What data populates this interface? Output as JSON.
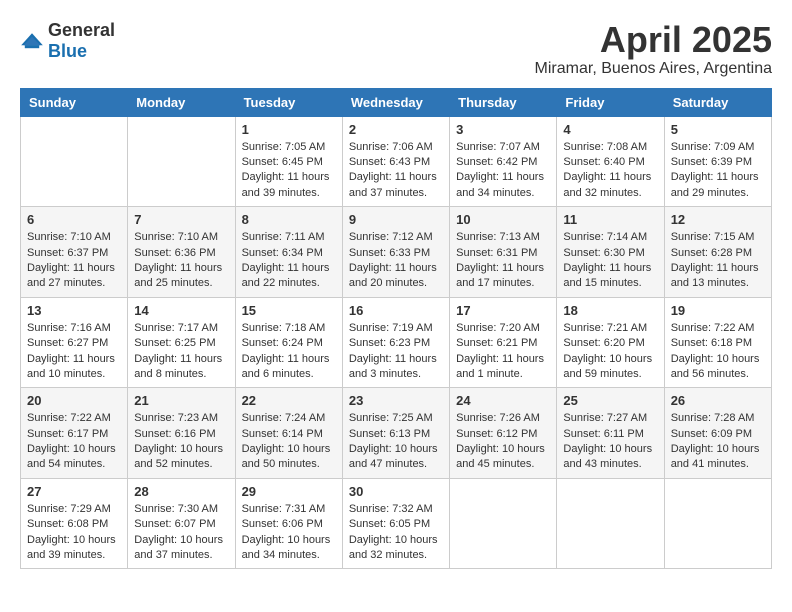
{
  "logo": {
    "general": "General",
    "blue": "Blue"
  },
  "header": {
    "title": "April 2025",
    "subtitle": "Miramar, Buenos Aires, Argentina"
  },
  "weekdays": [
    "Sunday",
    "Monday",
    "Tuesday",
    "Wednesday",
    "Thursday",
    "Friday",
    "Saturday"
  ],
  "weeks": [
    [
      {
        "day": "",
        "sunrise": "",
        "sunset": "",
        "daylight": ""
      },
      {
        "day": "",
        "sunrise": "",
        "sunset": "",
        "daylight": ""
      },
      {
        "day": "1",
        "sunrise": "Sunrise: 7:05 AM",
        "sunset": "Sunset: 6:45 PM",
        "daylight": "Daylight: 11 hours and 39 minutes."
      },
      {
        "day": "2",
        "sunrise": "Sunrise: 7:06 AM",
        "sunset": "Sunset: 6:43 PM",
        "daylight": "Daylight: 11 hours and 37 minutes."
      },
      {
        "day": "3",
        "sunrise": "Sunrise: 7:07 AM",
        "sunset": "Sunset: 6:42 PM",
        "daylight": "Daylight: 11 hours and 34 minutes."
      },
      {
        "day": "4",
        "sunrise": "Sunrise: 7:08 AM",
        "sunset": "Sunset: 6:40 PM",
        "daylight": "Daylight: 11 hours and 32 minutes."
      },
      {
        "day": "5",
        "sunrise": "Sunrise: 7:09 AM",
        "sunset": "Sunset: 6:39 PM",
        "daylight": "Daylight: 11 hours and 29 minutes."
      }
    ],
    [
      {
        "day": "6",
        "sunrise": "Sunrise: 7:10 AM",
        "sunset": "Sunset: 6:37 PM",
        "daylight": "Daylight: 11 hours and 27 minutes."
      },
      {
        "day": "7",
        "sunrise": "Sunrise: 7:10 AM",
        "sunset": "Sunset: 6:36 PM",
        "daylight": "Daylight: 11 hours and 25 minutes."
      },
      {
        "day": "8",
        "sunrise": "Sunrise: 7:11 AM",
        "sunset": "Sunset: 6:34 PM",
        "daylight": "Daylight: 11 hours and 22 minutes."
      },
      {
        "day": "9",
        "sunrise": "Sunrise: 7:12 AM",
        "sunset": "Sunset: 6:33 PM",
        "daylight": "Daylight: 11 hours and 20 minutes."
      },
      {
        "day": "10",
        "sunrise": "Sunrise: 7:13 AM",
        "sunset": "Sunset: 6:31 PM",
        "daylight": "Daylight: 11 hours and 17 minutes."
      },
      {
        "day": "11",
        "sunrise": "Sunrise: 7:14 AM",
        "sunset": "Sunset: 6:30 PM",
        "daylight": "Daylight: 11 hours and 15 minutes."
      },
      {
        "day": "12",
        "sunrise": "Sunrise: 7:15 AM",
        "sunset": "Sunset: 6:28 PM",
        "daylight": "Daylight: 11 hours and 13 minutes."
      }
    ],
    [
      {
        "day": "13",
        "sunrise": "Sunrise: 7:16 AM",
        "sunset": "Sunset: 6:27 PM",
        "daylight": "Daylight: 11 hours and 10 minutes."
      },
      {
        "day": "14",
        "sunrise": "Sunrise: 7:17 AM",
        "sunset": "Sunset: 6:25 PM",
        "daylight": "Daylight: 11 hours and 8 minutes."
      },
      {
        "day": "15",
        "sunrise": "Sunrise: 7:18 AM",
        "sunset": "Sunset: 6:24 PM",
        "daylight": "Daylight: 11 hours and 6 minutes."
      },
      {
        "day": "16",
        "sunrise": "Sunrise: 7:19 AM",
        "sunset": "Sunset: 6:23 PM",
        "daylight": "Daylight: 11 hours and 3 minutes."
      },
      {
        "day": "17",
        "sunrise": "Sunrise: 7:20 AM",
        "sunset": "Sunset: 6:21 PM",
        "daylight": "Daylight: 11 hours and 1 minute."
      },
      {
        "day": "18",
        "sunrise": "Sunrise: 7:21 AM",
        "sunset": "Sunset: 6:20 PM",
        "daylight": "Daylight: 10 hours and 59 minutes."
      },
      {
        "day": "19",
        "sunrise": "Sunrise: 7:22 AM",
        "sunset": "Sunset: 6:18 PM",
        "daylight": "Daylight: 10 hours and 56 minutes."
      }
    ],
    [
      {
        "day": "20",
        "sunrise": "Sunrise: 7:22 AM",
        "sunset": "Sunset: 6:17 PM",
        "daylight": "Daylight: 10 hours and 54 minutes."
      },
      {
        "day": "21",
        "sunrise": "Sunrise: 7:23 AM",
        "sunset": "Sunset: 6:16 PM",
        "daylight": "Daylight: 10 hours and 52 minutes."
      },
      {
        "day": "22",
        "sunrise": "Sunrise: 7:24 AM",
        "sunset": "Sunset: 6:14 PM",
        "daylight": "Daylight: 10 hours and 50 minutes."
      },
      {
        "day": "23",
        "sunrise": "Sunrise: 7:25 AM",
        "sunset": "Sunset: 6:13 PM",
        "daylight": "Daylight: 10 hours and 47 minutes."
      },
      {
        "day": "24",
        "sunrise": "Sunrise: 7:26 AM",
        "sunset": "Sunset: 6:12 PM",
        "daylight": "Daylight: 10 hours and 45 minutes."
      },
      {
        "day": "25",
        "sunrise": "Sunrise: 7:27 AM",
        "sunset": "Sunset: 6:11 PM",
        "daylight": "Daylight: 10 hours and 43 minutes."
      },
      {
        "day": "26",
        "sunrise": "Sunrise: 7:28 AM",
        "sunset": "Sunset: 6:09 PM",
        "daylight": "Daylight: 10 hours and 41 minutes."
      }
    ],
    [
      {
        "day": "27",
        "sunrise": "Sunrise: 7:29 AM",
        "sunset": "Sunset: 6:08 PM",
        "daylight": "Daylight: 10 hours and 39 minutes."
      },
      {
        "day": "28",
        "sunrise": "Sunrise: 7:30 AM",
        "sunset": "Sunset: 6:07 PM",
        "daylight": "Daylight: 10 hours and 37 minutes."
      },
      {
        "day": "29",
        "sunrise": "Sunrise: 7:31 AM",
        "sunset": "Sunset: 6:06 PM",
        "daylight": "Daylight: 10 hours and 34 minutes."
      },
      {
        "day": "30",
        "sunrise": "Sunrise: 7:32 AM",
        "sunset": "Sunset: 6:05 PM",
        "daylight": "Daylight: 10 hours and 32 minutes."
      },
      {
        "day": "",
        "sunrise": "",
        "sunset": "",
        "daylight": ""
      },
      {
        "day": "",
        "sunrise": "",
        "sunset": "",
        "daylight": ""
      },
      {
        "day": "",
        "sunrise": "",
        "sunset": "",
        "daylight": ""
      }
    ]
  ]
}
